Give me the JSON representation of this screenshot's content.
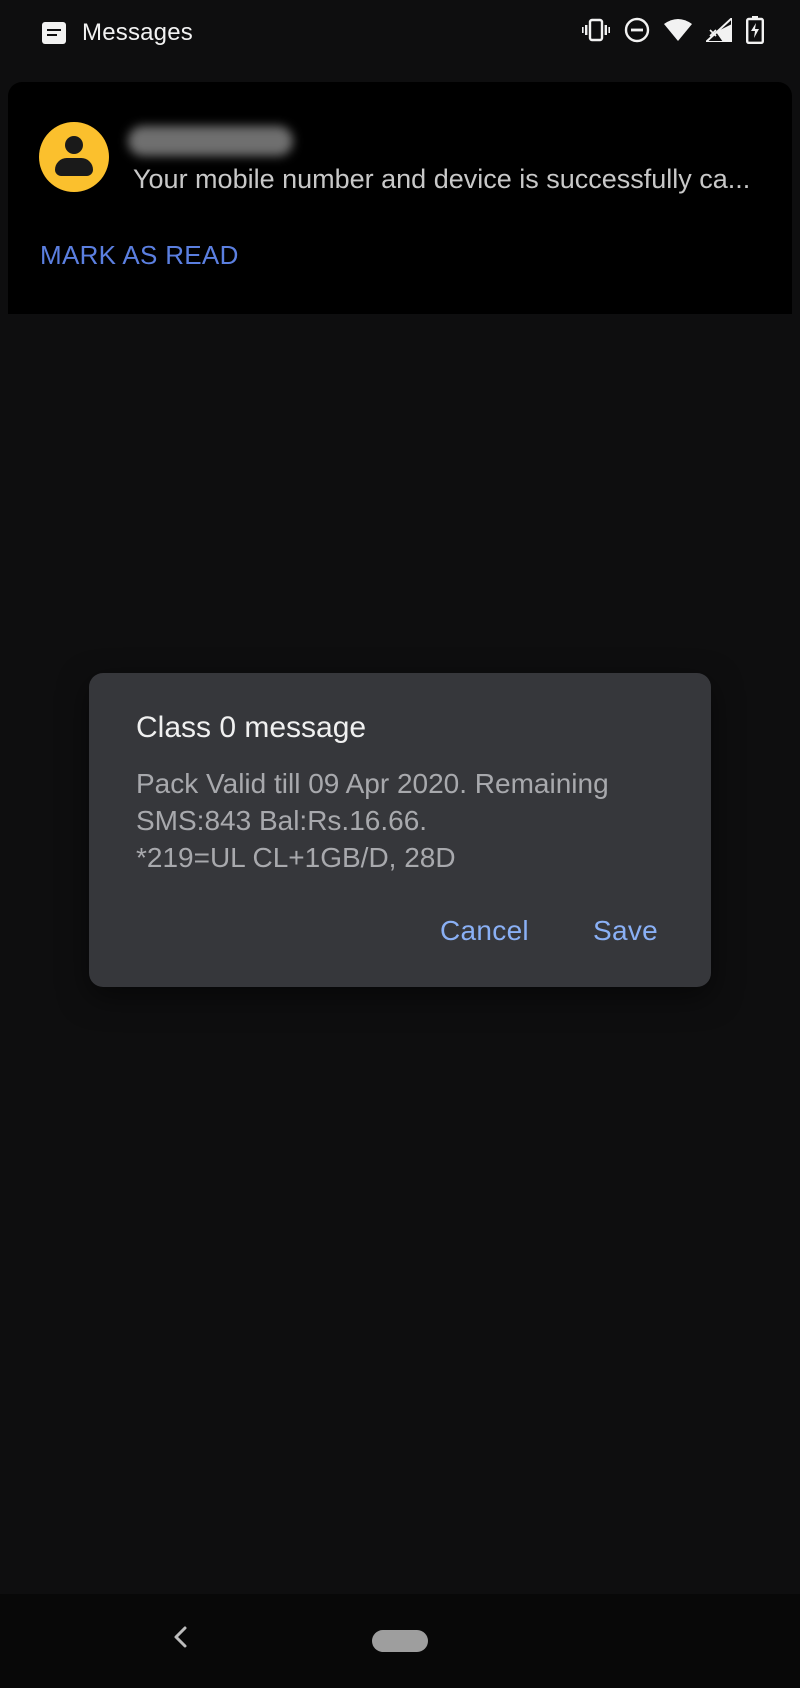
{
  "status_bar": {
    "app_name": "Messages",
    "icons": [
      "messages-app-icon",
      "vibrate-icon",
      "do-not-disturb-icon",
      "wifi-icon",
      "signal-icon",
      "battery-charging-icon"
    ]
  },
  "notification": {
    "sender": "",
    "preview": "Your mobile number and device is successfully ca...",
    "action_label": "MARK AS READ",
    "avatar_color": "#fbc02d"
  },
  "dialog": {
    "title": "Class 0 message",
    "body_lines": [
      "Pack Valid till 09 Apr 2020. Remaining",
      "SMS:843 Bal:Rs.16.66.",
      "*219=UL CL+1GB/D, 28D"
    ],
    "cancel_label": "Cancel",
    "save_label": "Save",
    "accent_color": "#8ab0f5"
  },
  "nav_bar": {
    "icons": [
      "back-icon",
      "home-pill-icon"
    ]
  },
  "colors": {
    "background": "#0e0e0f",
    "notification_bg": "#000000",
    "dialog_bg": "#36373b",
    "link_blue": "#5b7fe0"
  }
}
